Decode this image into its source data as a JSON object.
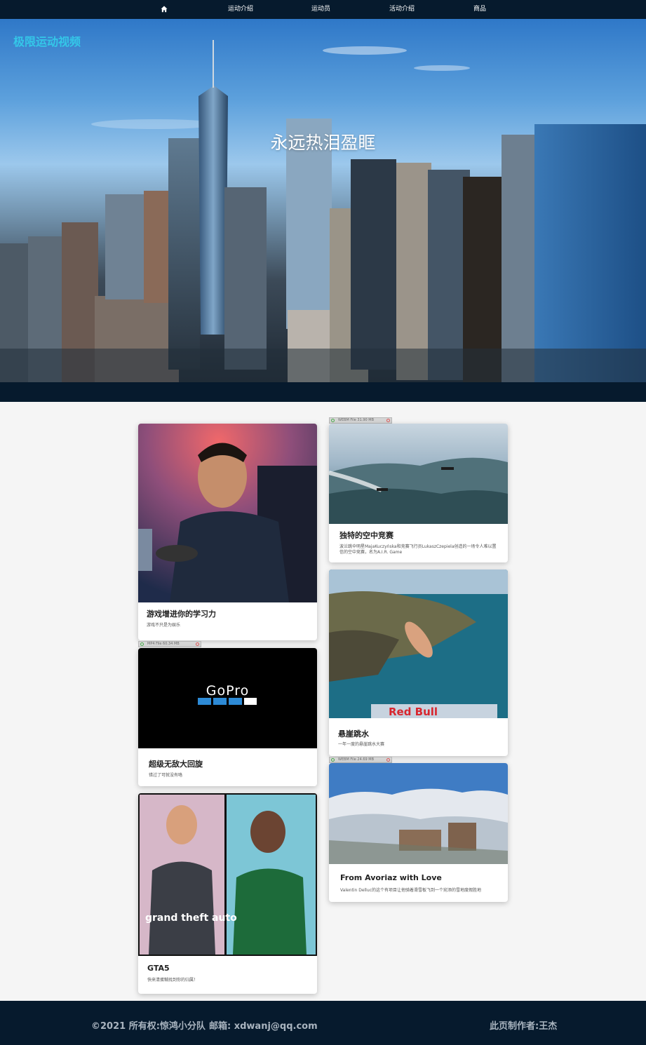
{
  "nav": {
    "home_icon": "home-icon",
    "items": [
      "运动介绍",
      "运动员",
      "活动介绍",
      "商品"
    ]
  },
  "hero": {
    "brand": "极限运动视频",
    "title": "永远热泪盈眶"
  },
  "cards": {
    "gaming": {
      "title": "游戏增进你的学习力",
      "desc": "游戏不只是为娱乐"
    },
    "gopro": {
      "file": "MP4 File 60.34 MB",
      "logo": "GoPro",
      "title": "超级无敌大回旋",
      "desc": "错过了可就没有咯"
    },
    "gta": {
      "title": "GTA5",
      "desc": "快来清蛋糊找到你的归属！",
      "art_text": "grand theft auto"
    },
    "air": {
      "file": "WEBM File 31.90 MB",
      "title": "独特的空中竞赛",
      "desc": "波兰跳伞明星MajaKuczyńska和竞赛飞行员LukaszCzepiela创造的一场令人难以置信的空中竞赛，名为A.I.R. Game"
    },
    "cliff": {
      "title": "悬崖跳水",
      "desc": "一年一度的悬崖跳水大赛",
      "banner": "Red Bull"
    },
    "avoriaz": {
      "file": "WEBM File 24.69 MB",
      "title": "From Avoriaz with Love",
      "desc": "Valentin Delluc的这个有项目让他骑着滑雪板飞到一个宛添的雪地度假胜地"
    }
  },
  "footer": {
    "copyright": "©2021 所有权:惊鸿小分队",
    "email": "邮箱: xdwanj@qq.com",
    "author": "此页制作者:王杰"
  }
}
